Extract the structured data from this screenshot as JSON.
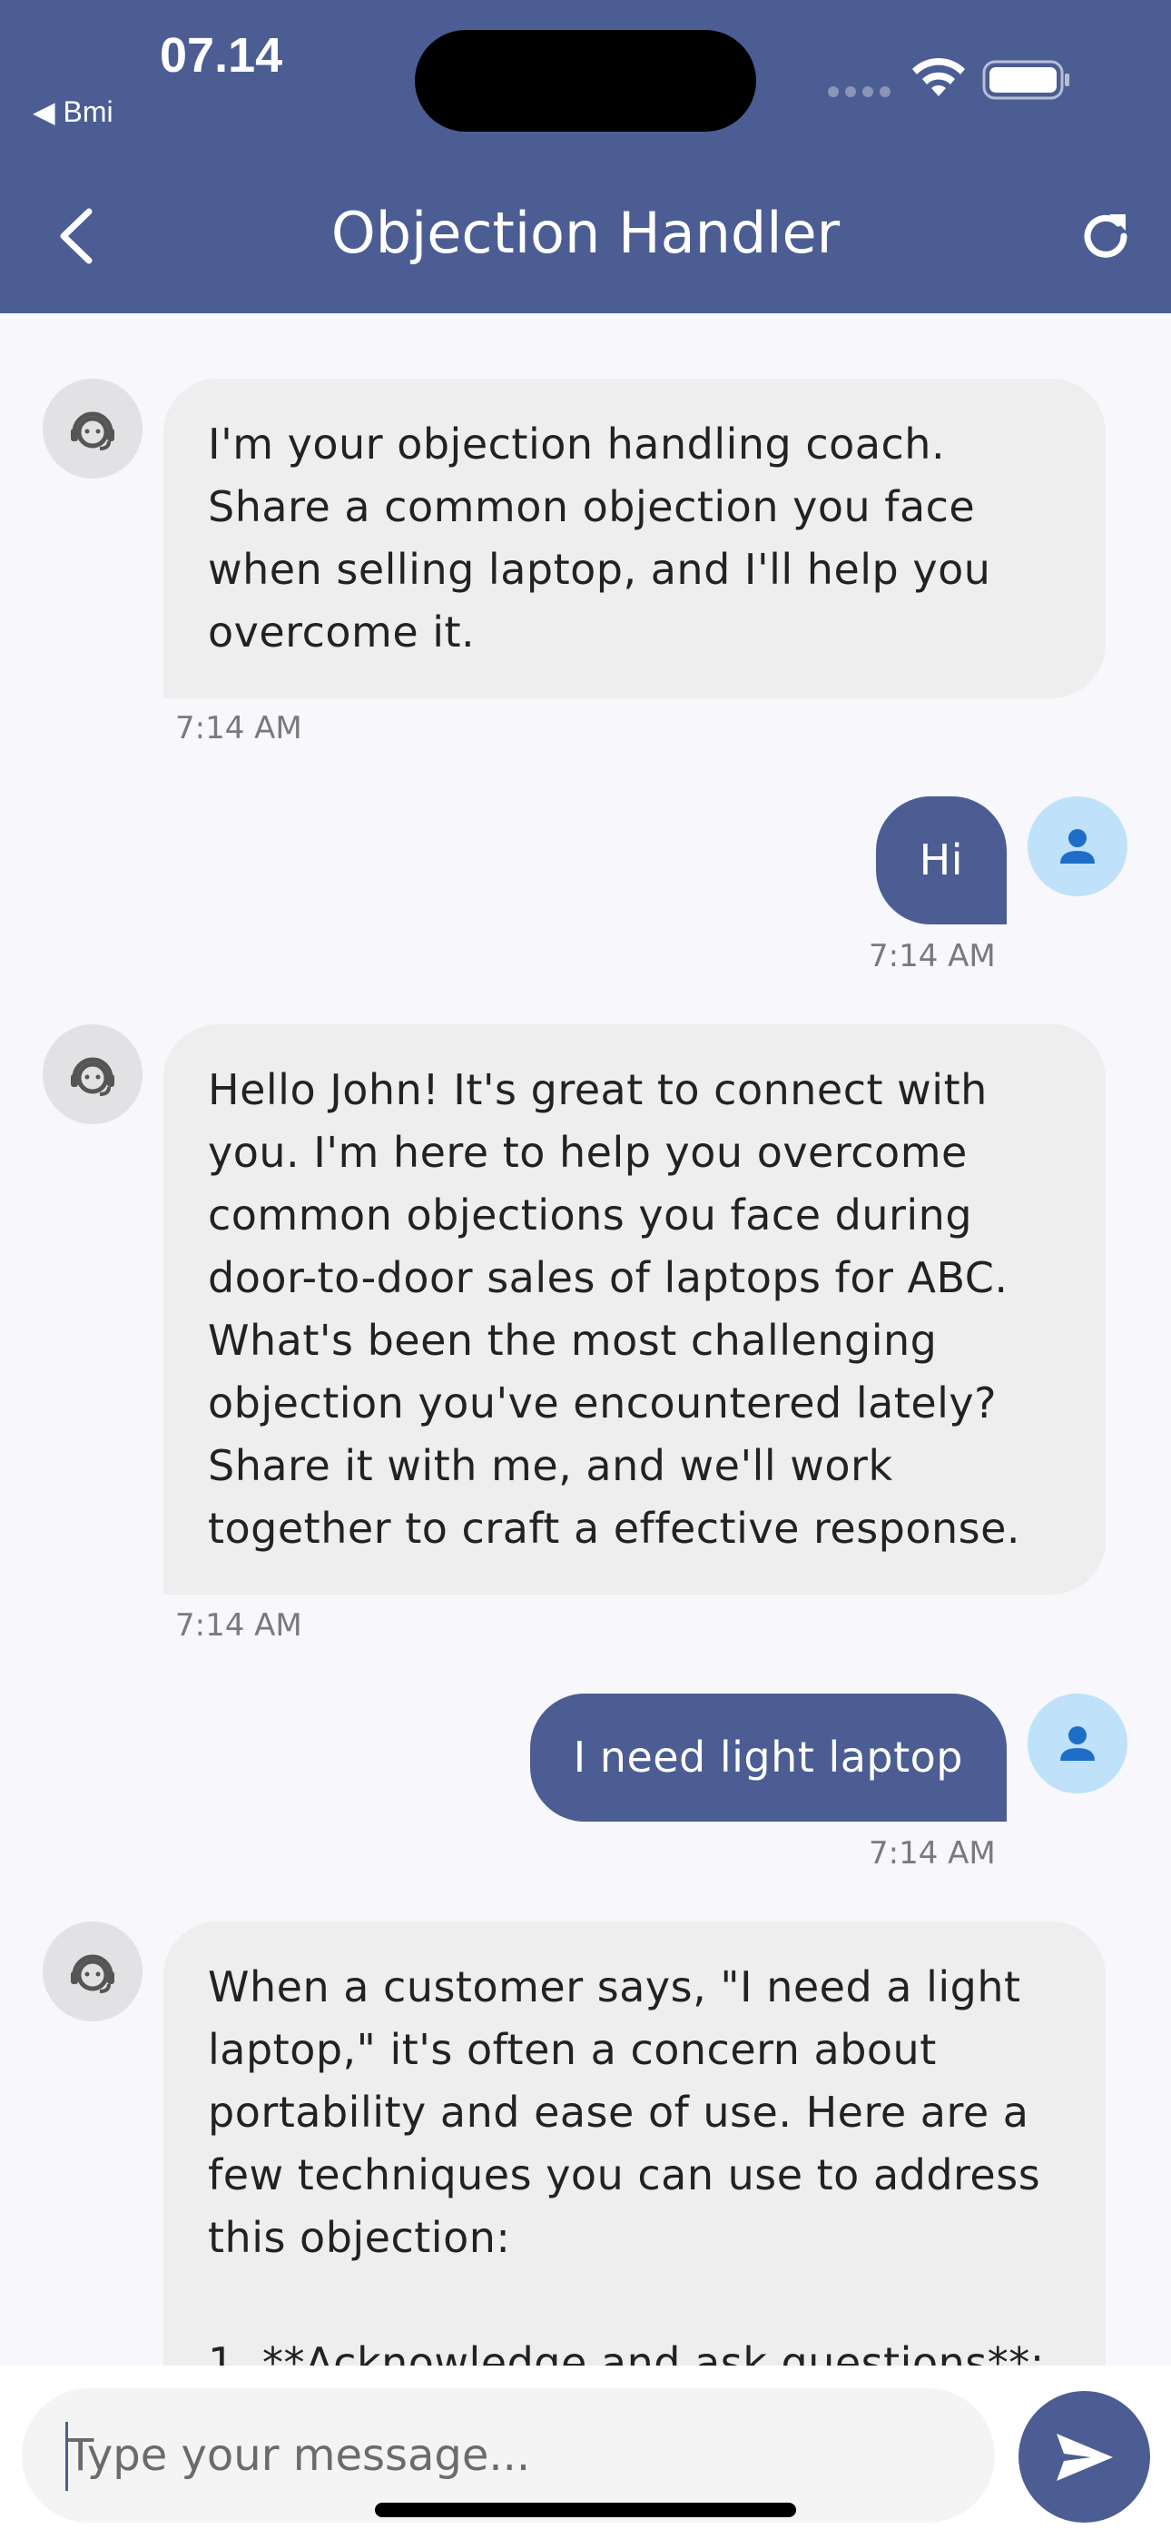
{
  "status_bar": {
    "time": "07.14",
    "back_app": "◀ Bmi"
  },
  "header": {
    "title": "Objection Handler"
  },
  "messages": [
    {
      "sender": "bot",
      "text": "I'm your objection handling coach.\nShare a common objection you face\nwhen selling laptop, and I'll help you\novercome it.",
      "time": "7:14 AM"
    },
    {
      "sender": "user",
      "text": "Hi",
      "time": "7:14 AM"
    },
    {
      "sender": "bot",
      "text": "Hello John! It's great to connect with\nyou. I'm here to help you overcome\ncommon objections you face during\ndoor-to-door sales of laptops for ABC.\nWhat's been the most challenging\nobjection you've encountered lately?\nShare it with me, and we'll work\ntogether to craft a effective response.",
      "time": "7:14 AM"
    },
    {
      "sender": "user",
      "text": "I need light laptop",
      "time": "7:14 AM"
    },
    {
      "sender": "bot",
      "text": "When a customer says, \"I need a light\nlaptop,\" it's often a concern about\nportability and ease of use. Here are a\nfew techniques you can use to address\nthis objection:\n\n1. **Acknowledge and ask questions**:",
      "time": ""
    }
  ],
  "input": {
    "placeholder": "Type your message..."
  },
  "colors": {
    "primary": "#4c5d93",
    "bot_bubble": "#eeeeee",
    "user_avatar": "#bfe1fa",
    "bot_avatar": "#e2e2e4",
    "background": "#f7f7fc"
  },
  "icons": {
    "back": "chevron-left-icon",
    "refresh": "refresh-icon",
    "bot_avatar": "support-agent-icon",
    "user_avatar": "person-icon",
    "send": "send-icon"
  }
}
